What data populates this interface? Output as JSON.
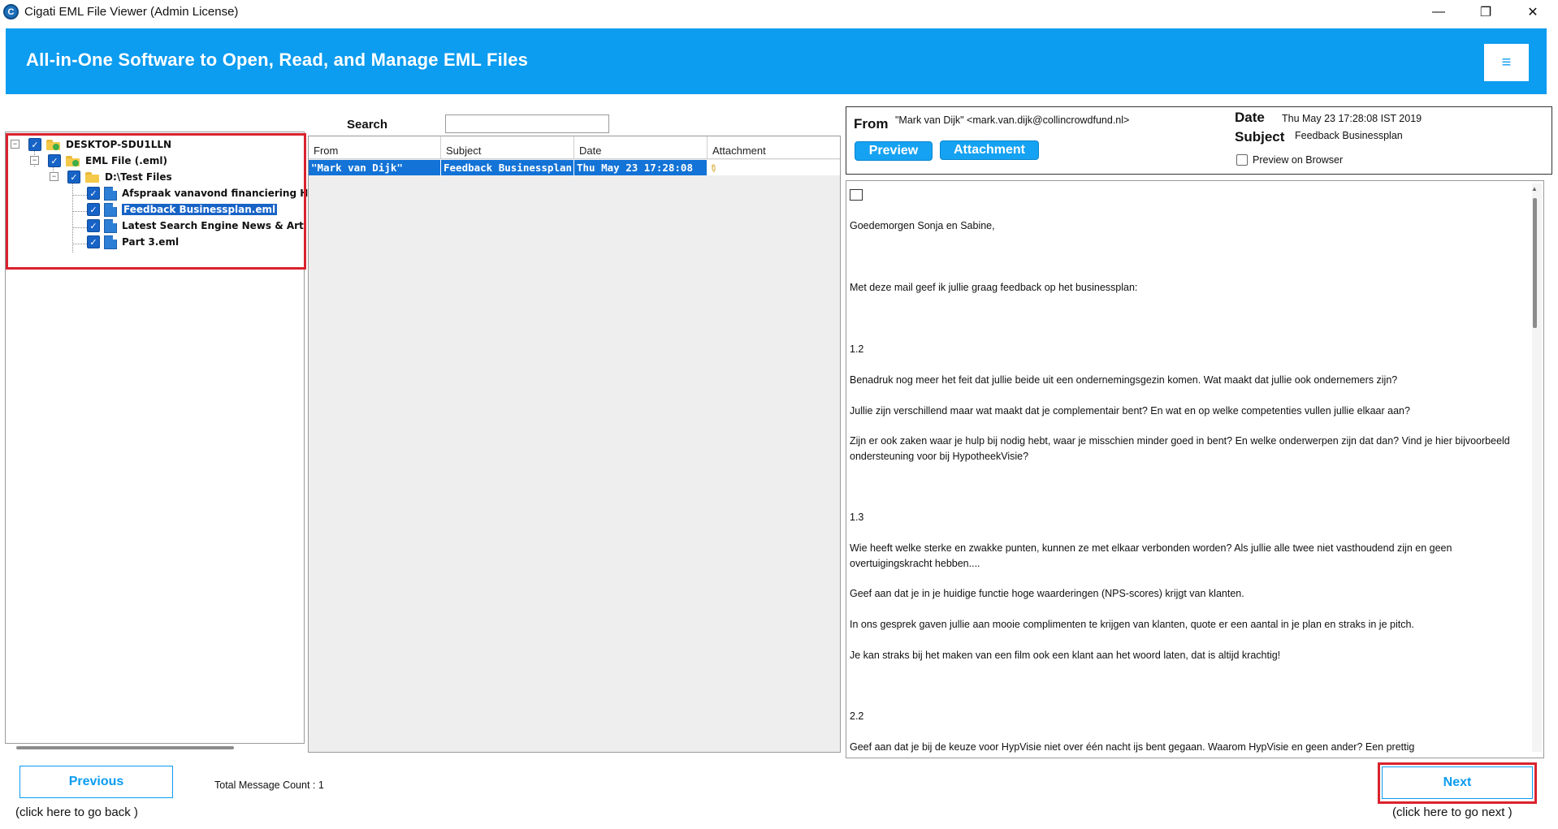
{
  "window": {
    "title": "Cigati EML File Viewer (Admin License)",
    "app_icon_letter": "C",
    "minimize_glyph": "—",
    "maximize_glyph": "❐",
    "close_glyph": "✕"
  },
  "banner": {
    "title": "All-in-One Software to Open, Read, and Manage EML Files",
    "menu_glyph": "≡",
    "background_color": "#0c9cf0"
  },
  "tree": {
    "root": "DESKTOP-SDU1LLN",
    "store": "EML File (.eml)",
    "folder": "D:\\Test Files",
    "files": [
      "Afspraak vanavond financiering H",
      "Feedback Businessplan.eml",
      "Latest Search Engine News & Arti",
      "Part 3.eml"
    ],
    "selected_index": 1
  },
  "search": {
    "label": "Search",
    "value": ""
  },
  "grid": {
    "columns": [
      "From",
      "Subject",
      "Date",
      "Attachment"
    ],
    "rows": [
      {
        "from": "\"Mark van Dijk\"",
        "subject": "Feedback Businessplan",
        "date": "Thu May 23 17:28:08",
        "attachment_icon": "paperclip-icon"
      }
    ]
  },
  "message": {
    "from_label": "From",
    "from_value": "\"Mark van Dijk\" <mark.van.dijk@collincrowdfund.nl>",
    "date_label": "Date",
    "date_value": "Thu May 23 17:28:08 IST 2019",
    "subject_label": "Subject",
    "subject_value": "Feedback Businessplan",
    "preview_button": "Preview",
    "attachment_button": "Attachment",
    "preview_browser_label": "Preview on Browser",
    "body": [
      "",
      "Goedemorgen Sonja en Sabine,",
      "Met deze mail geef ik jullie graag feedback op het businessplan:",
      "1.2",
      "Benadruk nog meer het feit dat jullie beide uit een ondernemingsgezin komen. Wat maakt dat jullie ook ondernemers zijn?",
      "Jullie zijn verschillend maar wat maakt dat je complementair bent? En wat en op welke competenties vullen jullie elkaar aan?",
      "Zijn er ook zaken waar je hulp bij nodig hebt, waar je misschien minder goed in bent? En welke onderwerpen zijn dat dan? Vind je hier bijvoorbeeld ondersteuning voor bij HypotheekVisie?",
      "1.3",
      "Wie heeft welke sterke en zwakke punten, kunnen ze met elkaar verbonden worden? Als jullie alle twee niet vasthoudend zijn en geen overtuigingskracht hebben....",
      "Geef aan dat je in je huidige functie hoge waarderingen (NPS-scores) krijgt van klanten.",
      "In ons gesprek gaven jullie aan mooie complimenten te krijgen van klanten, quote er een aantal in je plan en straks in je pitch.",
      "Je kan straks bij het maken van een film ook een klant aan het woord laten, dat is altijd krachtig!",
      "2.2",
      "Geef aan dat je bij de keuze voor HypVisie niet over één nacht ijs bent gegaan. Waarom HypVisie en geen ander? Een prettig"
    ]
  },
  "footer": {
    "previous_label": "Previous",
    "previous_hint": "(click here to  go back )",
    "count_text": "Total Message Count : 1",
    "next_label": "Next",
    "next_hint": "(click here to  go next )"
  }
}
